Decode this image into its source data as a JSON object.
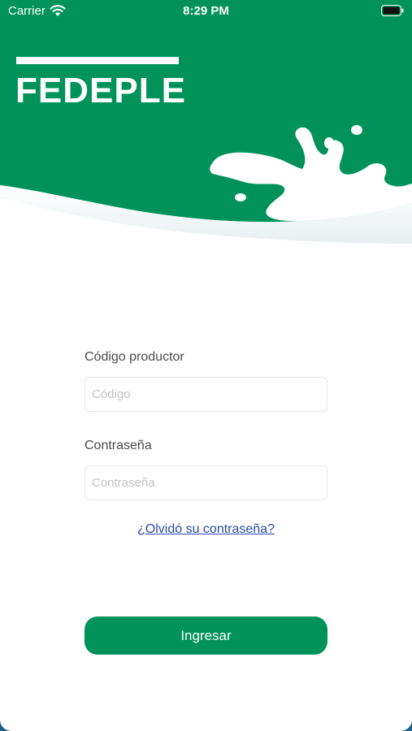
{
  "status_bar": {
    "carrier": "Carrier",
    "time": "8:29 PM"
  },
  "brand": {
    "name": "FEDEPLE"
  },
  "form": {
    "code_label": "Código productor",
    "code_placeholder": "Código",
    "password_label": "Contraseña",
    "password_placeholder": "Contraseña",
    "forgot_link": "¿Olvidó su contraseña?",
    "submit_label": "Ingresar"
  },
  "colors": {
    "brand_green": "#00925a",
    "link_blue": "#2b4aa8"
  },
  "icons": [
    "wifi-icon",
    "battery-icon",
    "milk-splash-decoration"
  ]
}
